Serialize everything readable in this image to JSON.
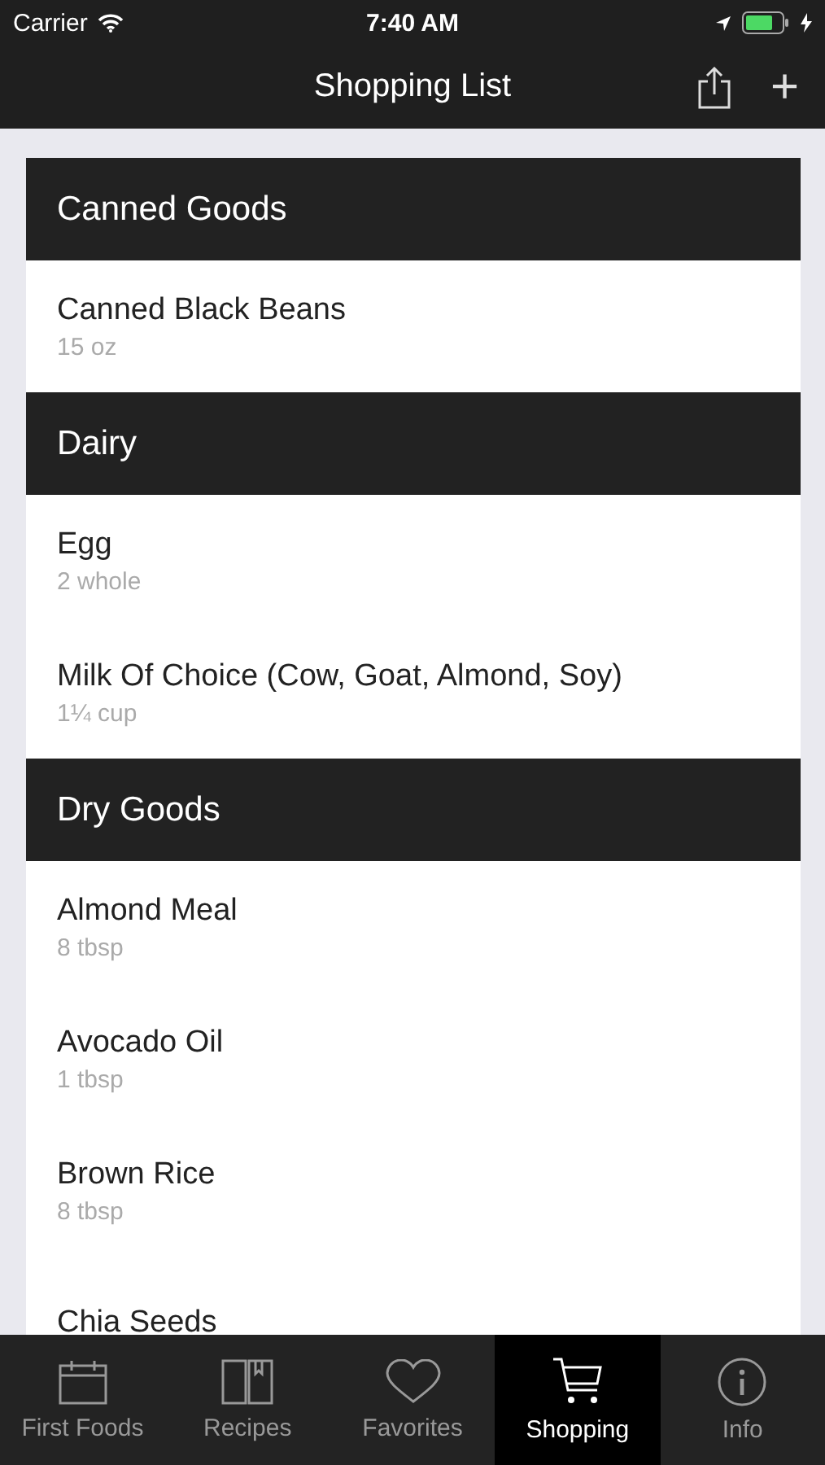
{
  "status_bar": {
    "carrier": "Carrier",
    "time": "7:40 AM"
  },
  "nav": {
    "title": "Shopping List",
    "add_label": "+"
  },
  "sections": [
    {
      "title": "Canned Goods",
      "items": [
        {
          "name": "Canned Black Beans",
          "detail": "15 oz"
        }
      ]
    },
    {
      "title": "Dairy",
      "items": [
        {
          "name": "Egg",
          "detail": "2 whole"
        },
        {
          "name": "Milk Of Choice (Cow, Goat, Almond, Soy)",
          "detail": "1¼ cup"
        }
      ]
    },
    {
      "title": "Dry Goods",
      "items": [
        {
          "name": "Almond Meal",
          "detail": "8 tbsp"
        },
        {
          "name": "Avocado Oil",
          "detail": "1 tbsp"
        },
        {
          "name": "Brown Rice",
          "detail": "8 tbsp"
        },
        {
          "name": "Chia Seeds"
        }
      ]
    }
  ],
  "tabs": [
    {
      "label": "First Foods",
      "kind": "calendar",
      "selected": false
    },
    {
      "label": "Recipes",
      "kind": "book",
      "selected": false
    },
    {
      "label": "Favorites",
      "kind": "heart",
      "selected": false
    },
    {
      "label": "Shopping",
      "kind": "cart",
      "selected": true
    },
    {
      "label": "Info",
      "kind": "info",
      "selected": false
    }
  ]
}
